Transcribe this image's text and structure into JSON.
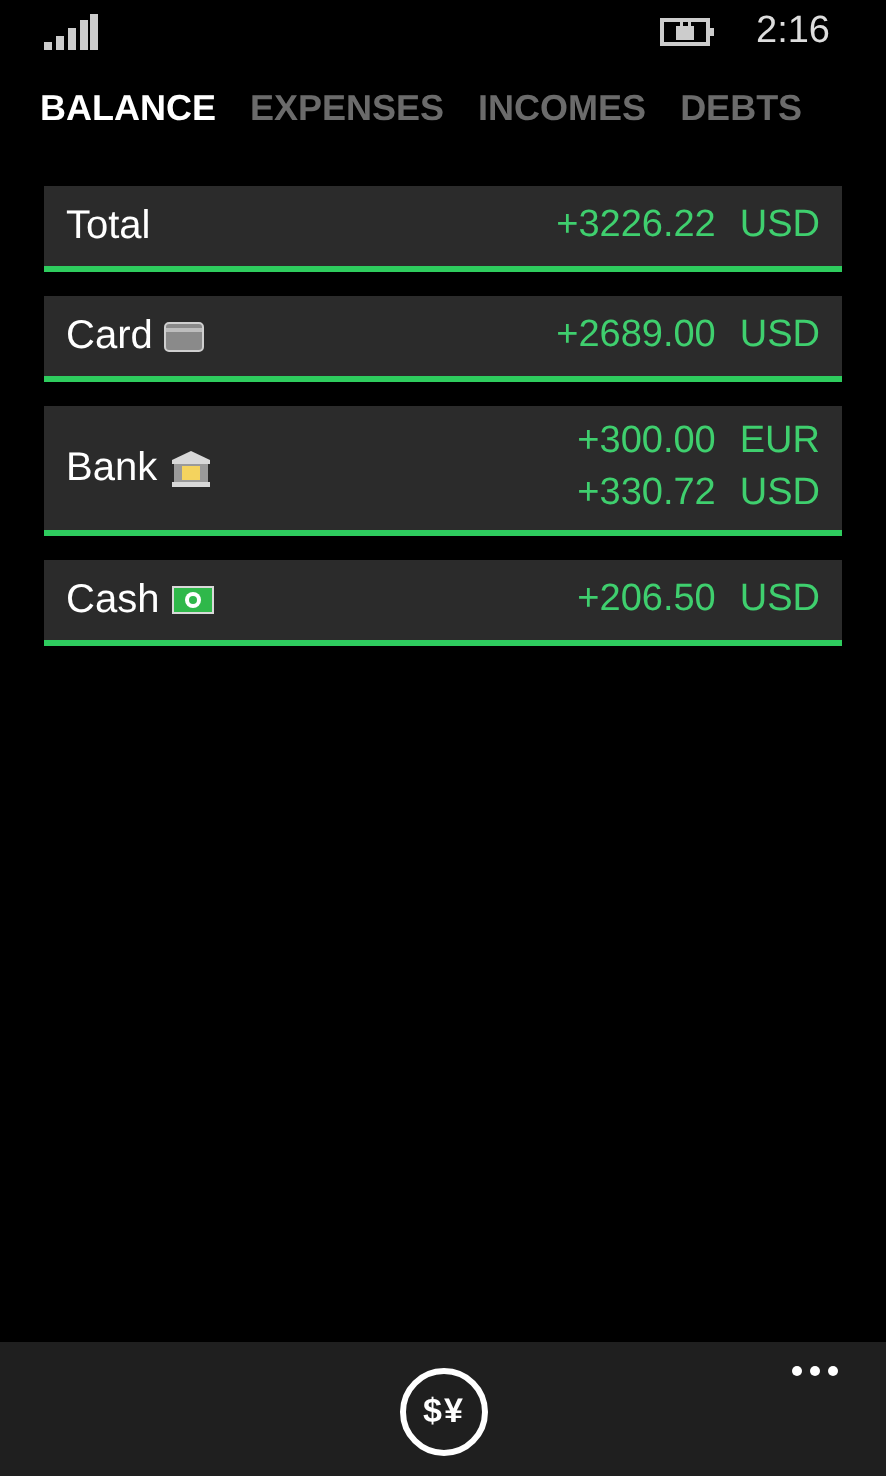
{
  "status_bar": {
    "time": "2:16"
  },
  "tabs": [
    {
      "label": "BALANCE",
      "selected": true
    },
    {
      "label": "EXPENSES",
      "selected": false
    },
    {
      "label": "INCOMES",
      "selected": false
    },
    {
      "label": "DEBTS",
      "selected": false
    }
  ],
  "accounts": [
    {
      "name": "Total",
      "kind": "total",
      "amounts": [
        {
          "value": "+3226.22",
          "currency": "USD"
        }
      ]
    },
    {
      "name": "Card",
      "kind": "card",
      "amounts": [
        {
          "value": "+2689.00",
          "currency": "USD"
        }
      ]
    },
    {
      "name": "Bank",
      "kind": "bank",
      "amounts": [
        {
          "value": "+300.00",
          "currency": "EUR"
        },
        {
          "value": "+330.72",
          "currency": "USD"
        }
      ]
    },
    {
      "name": "Cash",
      "kind": "cash",
      "amounts": [
        {
          "value": "+206.50",
          "currency": "USD"
        }
      ]
    }
  ],
  "app_bar": {
    "exchange_symbols": [
      "$",
      "¥"
    ]
  }
}
